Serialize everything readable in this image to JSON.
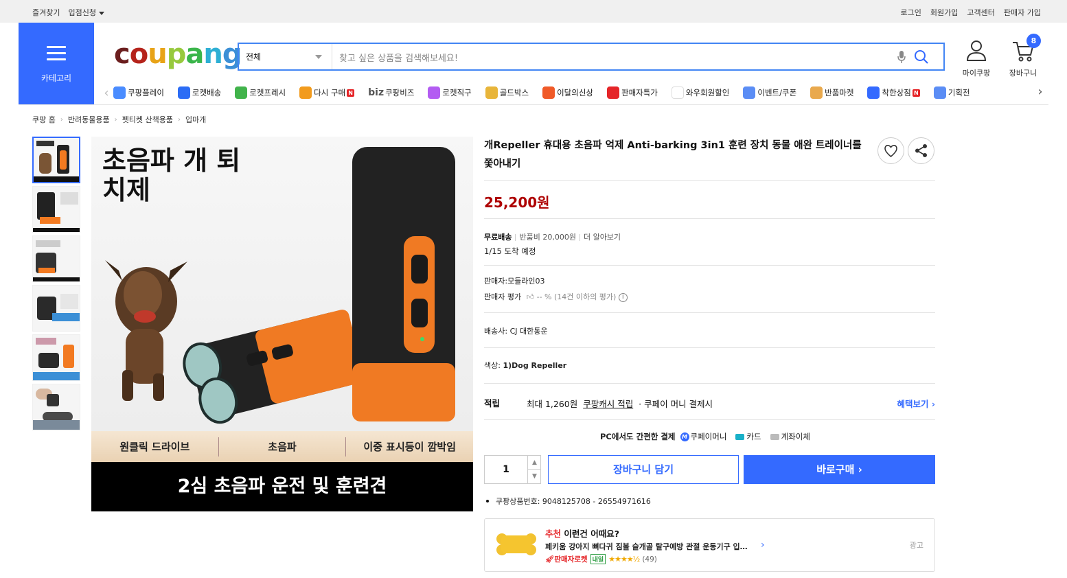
{
  "topbar": {
    "bookmark": "즐겨찾기",
    "seller_apply": "입점신청",
    "login": "로그인",
    "signup": "회원가입",
    "customer_center": "고객센터",
    "seller_signup": "판매자 가입"
  },
  "header": {
    "category_label": "카테고리",
    "logo": "coupang",
    "search_scope": "전체",
    "search_placeholder": "찾고 싶은 상품을 검색해보세요!",
    "mycoupang": "마이쿠팡",
    "cart": "장바구니",
    "cart_count": "8"
  },
  "quick_menu": [
    {
      "label": "쿠팡플레이",
      "color": "#4a8cff",
      "icon": "play-icon",
      "new": false
    },
    {
      "label": "로켓배송",
      "color": "#2b6cf5",
      "icon": "rocket-icon",
      "new": false
    },
    {
      "label": "로켓프레시",
      "color": "#41b34b",
      "icon": "rocket-fresh-icon",
      "new": false
    },
    {
      "label": "다시 구매",
      "color": "#f29b1d",
      "icon": "basket-icon",
      "new": true
    },
    {
      "label": "쿠팡비즈",
      "color": "#ffffff",
      "icon": "biz-icon",
      "new": false,
      "prefix": "biz"
    },
    {
      "label": "로켓직구",
      "color": "#b35cf2",
      "icon": "globe-icon",
      "new": false
    },
    {
      "label": "골드박스",
      "color": "#e8b53a",
      "icon": "goldbox-icon",
      "new": false
    },
    {
      "label": "이달의신상",
      "color": "#f05a28",
      "icon": "new-bag-icon",
      "new": false
    },
    {
      "label": "판매자특가",
      "color": "#e52528",
      "icon": "percent-icon",
      "new": false
    },
    {
      "label": "와우회원할인",
      "color": "#ffffff",
      "icon": "wow-icon",
      "new": false
    },
    {
      "label": "이벤트/쿠폰",
      "color": "#5b8df5",
      "icon": "coupon-icon",
      "new": false
    },
    {
      "label": "반품마켓",
      "color": "#e9a94d",
      "icon": "market-icon",
      "new": false
    },
    {
      "label": "착한상점",
      "color": "#346aff",
      "icon": "store-icon",
      "new": true
    },
    {
      "label": "기획전",
      "color": "#5b8df5",
      "icon": "tag-icon",
      "new": false
    }
  ],
  "breadcrumb": [
    "쿠팡 홈",
    "반려동물용품",
    "펫티켓 산책용품",
    "입마개"
  ],
  "product": {
    "title": "개Repeller 휴대용 초음파 억제 Anti-barking 3in1 훈련 장치 동물 애완 트레이너를 쫓아내기",
    "price": "25,200원",
    "ship_type": "무료배송",
    "return_fee": "반품비 20,000원",
    "more": "더 알아보기",
    "arrival": "1/15 도착 예정",
    "seller": "판매자:모들라인03",
    "seller_rating_label": "판매자 평가",
    "seller_rating_value": "-- % (14건 이하의 평가)",
    "carrier_label": "배송사:",
    "carrier": "CJ 대한통운",
    "color_label": "색상:",
    "color_value": "1)Dog Repeller",
    "reward_label": "적립",
    "reward_max": "최대 1,260원",
    "reward_link": "쿠팡캐시 적립",
    "reward_tail": "· 쿠페이 머니 결제시",
    "benefit_link": "혜택보기",
    "pay_title": "PC에서도 간편한 결제",
    "pay_methods": [
      "쿠페이머니",
      "카드",
      "계좌이체"
    ],
    "quantity": "1",
    "add_cart": "장바구니 담기",
    "buy_now": "바로구매",
    "product_no": "쿠팡상품번호: 9048125708 - 26554971616"
  },
  "image": {
    "headline": "초음파 개 퇴\n치제",
    "features": [
      "원클릭 드라이브",
      "초음파",
      "이중 표시등이 깜박임"
    ],
    "footer": "2심 초음파 운전 및 훈련견"
  },
  "recommend": {
    "tag": "추천",
    "title": "이런건 어때요?",
    "item": "페키움 강아지 뼈다귀 짐볼 슬개골 탈구예방 관절 운동기구 입…",
    "ad": "광고",
    "badge": "판매자로켓",
    "tomorrow": "내일",
    "stars": 4.5,
    "reviews": "(49)"
  }
}
